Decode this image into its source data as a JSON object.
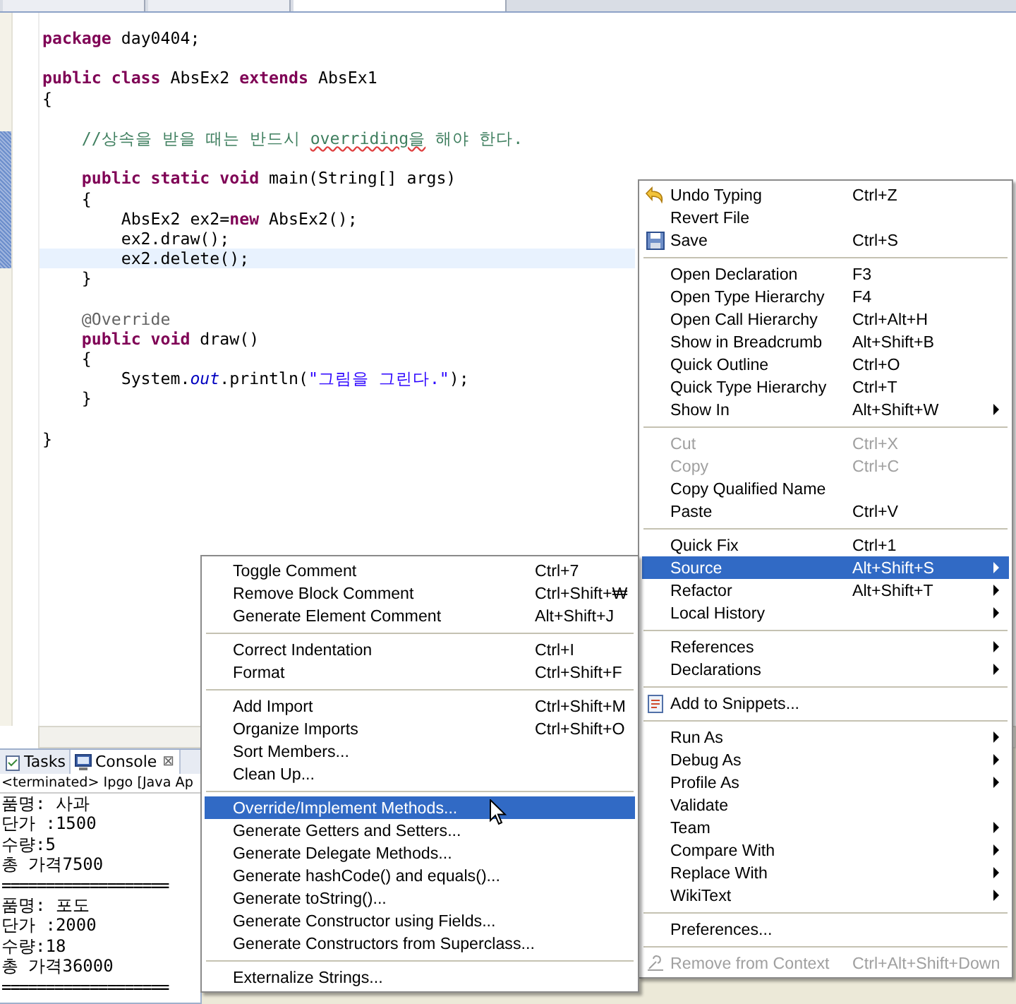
{
  "editor_tabs": [
    {
      "selected": false
    },
    {
      "selected": false
    },
    {
      "selected": true
    }
  ],
  "code_lines": [
    {
      "current": false,
      "gap_before": false,
      "segments": [
        {
          "kind": "keyword",
          "text": "package"
        },
        {
          "kind": "plain",
          "text": " day0404;"
        }
      ]
    },
    {
      "current": false,
      "gap_before": true,
      "segments": [
        {
          "kind": "keyword",
          "text": "public class"
        },
        {
          "kind": "plain",
          "text": " AbsEx2 "
        },
        {
          "kind": "keyword",
          "text": "extends"
        },
        {
          "kind": "plain",
          "text": " AbsEx1"
        }
      ]
    },
    {
      "current": false,
      "gap_before": false,
      "segments": [
        {
          "kind": "plain",
          "text": "{"
        }
      ]
    },
    {
      "current": false,
      "gap_before": true,
      "segments": [
        {
          "kind": "comment",
          "text": "    //상속을 받을 때는 반드시 "
        },
        {
          "kind": "misspelled",
          "text": "overriding을"
        },
        {
          "kind": "comment",
          "text": " 해야 한다."
        }
      ]
    },
    {
      "current": false,
      "gap_before": true,
      "segments": [
        {
          "kind": "keyword",
          "text": "    public static void"
        },
        {
          "kind": "plain",
          "text": " main(String[] args)"
        }
      ]
    },
    {
      "current": false,
      "gap_before": false,
      "segments": [
        {
          "kind": "plain",
          "text": "    {"
        }
      ]
    },
    {
      "current": false,
      "gap_before": false,
      "segments": [
        {
          "kind": "plain",
          "text": "        AbsEx2 ex2="
        },
        {
          "kind": "keyword",
          "text": "new"
        },
        {
          "kind": "plain",
          "text": " AbsEx2();"
        }
      ]
    },
    {
      "current": false,
      "gap_before": false,
      "segments": [
        {
          "kind": "plain",
          "text": "        ex2.draw();"
        }
      ]
    },
    {
      "current": true,
      "gap_before": false,
      "segments": [
        {
          "kind": "plain",
          "text": "        ex2.delete();"
        }
      ]
    },
    {
      "current": false,
      "gap_before": false,
      "segments": [
        {
          "kind": "plain",
          "text": "    }"
        }
      ]
    },
    {
      "current": false,
      "gap_before": true,
      "segments": [
        {
          "kind": "annotation",
          "text": "    @Override"
        }
      ]
    },
    {
      "current": false,
      "gap_before": false,
      "segments": [
        {
          "kind": "keyword",
          "text": "    public void"
        },
        {
          "kind": "plain",
          "text": " draw()"
        }
      ]
    },
    {
      "current": false,
      "gap_before": false,
      "segments": [
        {
          "kind": "plain",
          "text": "    {"
        }
      ]
    },
    {
      "current": false,
      "gap_before": false,
      "segments": [
        {
          "kind": "plain",
          "text": "        System."
        },
        {
          "kind": "field",
          "text": "out"
        },
        {
          "kind": "plain",
          "text": ".println("
        },
        {
          "kind": "string",
          "text": "\"그림을 그린다.\""
        },
        {
          "kind": "plain",
          "text": ");"
        }
      ]
    },
    {
      "current": false,
      "gap_before": false,
      "segments": [
        {
          "kind": "plain",
          "text": "    }"
        }
      ]
    },
    {
      "current": false,
      "gap_before": true,
      "segments": [
        {
          "kind": "plain",
          "text": "}"
        }
      ]
    }
  ],
  "console": {
    "tabs": [
      {
        "label": "Tasks",
        "selected": false
      },
      {
        "label": "Console",
        "selected": true
      }
    ],
    "close": "⊠",
    "status": "<terminated> Ipgo [Java Ap",
    "lines": [
      {
        "kind": "output",
        "text": "품명: 사과"
      },
      {
        "kind": "output",
        "text": "단가 :1500"
      },
      {
        "kind": "output",
        "text": "수량:5"
      },
      {
        "kind": "output",
        "text": "총 가격7500"
      },
      {
        "kind": "rule",
        "text": "==================="
      },
      {
        "kind": "output",
        "text": "품명: 포도"
      },
      {
        "kind": "output",
        "text": "단가 :2000"
      },
      {
        "kind": "output",
        "text": "수량:18"
      },
      {
        "kind": "output",
        "text": "총 가격36000"
      },
      {
        "kind": "rule",
        "text": "==================="
      }
    ]
  },
  "context_menu": {
    "groups": [
      [
        {
          "label": "Undo Typing",
          "shortcut": "Ctrl+Z",
          "submenu": false,
          "disabled": false,
          "selected": false
        },
        {
          "label": "Revert File",
          "submenu": false,
          "disabled": false,
          "selected": false
        },
        {
          "label": "Save",
          "shortcut": "Ctrl+S",
          "submenu": false,
          "disabled": false,
          "selected": false
        }
      ],
      [
        {
          "label": "Open Declaration",
          "shortcut": "F3",
          "submenu": false,
          "disabled": false,
          "selected": false
        },
        {
          "label": "Open Type Hierarchy",
          "shortcut": "F4",
          "submenu": false,
          "disabled": false,
          "selected": false
        },
        {
          "label": "Open Call Hierarchy",
          "shortcut": "Ctrl+Alt+H",
          "submenu": false,
          "disabled": false,
          "selected": false
        },
        {
          "label": "Show in Breadcrumb",
          "shortcut": "Alt+Shift+B",
          "submenu": false,
          "disabled": false,
          "selected": false
        },
        {
          "label": "Quick Outline",
          "shortcut": "Ctrl+O",
          "submenu": false,
          "disabled": false,
          "selected": false
        },
        {
          "label": "Quick Type Hierarchy",
          "shortcut": "Ctrl+T",
          "submenu": false,
          "disabled": false,
          "selected": false
        },
        {
          "label": "Show In",
          "shortcut": "Alt+Shift+W",
          "submenu": true,
          "disabled": false,
          "selected": false
        }
      ],
      [
        {
          "label": "Cut",
          "shortcut": "Ctrl+X",
          "submenu": false,
          "disabled": true,
          "selected": false
        },
        {
          "label": "Copy",
          "shortcut": "Ctrl+C",
          "submenu": false,
          "disabled": true,
          "selected": false
        },
        {
          "label": "Copy Qualified Name",
          "submenu": false,
          "disabled": false,
          "selected": false
        },
        {
          "label": "Paste",
          "shortcut": "Ctrl+V",
          "submenu": false,
          "disabled": false,
          "selected": false
        }
      ],
      [
        {
          "label": "Quick Fix",
          "shortcut": "Ctrl+1",
          "submenu": false,
          "disabled": false,
          "selected": false
        },
        {
          "label": "Source",
          "shortcut": "Alt+Shift+S",
          "submenu": true,
          "disabled": false,
          "selected": true
        },
        {
          "label": "Refactor",
          "shortcut": "Alt+Shift+T",
          "submenu": true,
          "disabled": false,
          "selected": false
        },
        {
          "label": "Local History",
          "submenu": true,
          "disabled": false,
          "selected": false
        }
      ],
      [
        {
          "label": "References",
          "submenu": true,
          "disabled": false,
          "selected": false
        },
        {
          "label": "Declarations",
          "submenu": true,
          "disabled": false,
          "selected": false
        }
      ],
      [
        {
          "label": "Add to Snippets...",
          "submenu": false,
          "disabled": false,
          "selected": false
        }
      ],
      [
        {
          "label": "Run As",
          "submenu": true,
          "disabled": false,
          "selected": false
        },
        {
          "label": "Debug As",
          "submenu": true,
          "disabled": false,
          "selected": false
        },
        {
          "label": "Profile As",
          "submenu": true,
          "disabled": false,
          "selected": false
        },
        {
          "label": "Validate",
          "submenu": false,
          "disabled": false,
          "selected": false
        },
        {
          "label": "Team",
          "submenu": true,
          "disabled": false,
          "selected": false
        },
        {
          "label": "Compare With",
          "submenu": true,
          "disabled": false,
          "selected": false
        },
        {
          "label": "Replace With",
          "submenu": true,
          "disabled": false,
          "selected": false
        },
        {
          "label": "WikiText",
          "submenu": true,
          "disabled": false,
          "selected": false
        }
      ],
      [
        {
          "label": "Preferences...",
          "submenu": false,
          "disabled": false,
          "selected": false
        }
      ],
      [
        {
          "label": "Remove from Context",
          "shortcut": "Ctrl+Alt+Shift+Down",
          "submenu": false,
          "disabled": true,
          "selected": false
        }
      ]
    ]
  },
  "source_submenu": {
    "groups": [
      [
        {
          "label": "Toggle Comment",
          "shortcut": "Ctrl+7",
          "selected": false
        },
        {
          "label": "Remove Block Comment",
          "shortcut": "Ctrl+Shift+₩",
          "selected": false
        },
        {
          "label": "Generate Element Comment",
          "shortcut": "Alt+Shift+J",
          "selected": false
        }
      ],
      [
        {
          "label": "Correct Indentation",
          "shortcut": "Ctrl+I",
          "selected": false
        },
        {
          "label": "Format",
          "shortcut": "Ctrl+Shift+F",
          "selected": false
        }
      ],
      [
        {
          "label": "Add Import",
          "shortcut": "Ctrl+Shift+M",
          "selected": false
        },
        {
          "label": "Organize Imports",
          "shortcut": "Ctrl+Shift+O",
          "selected": false
        },
        {
          "label": "Sort Members...",
          "selected": false
        },
        {
          "label": "Clean Up...",
          "selected": false
        }
      ],
      [
        {
          "label": "Override/Implement Methods...",
          "selected": true
        },
        {
          "label": "Generate Getters and Setters...",
          "selected": false
        },
        {
          "label": "Generate Delegate Methods...",
          "selected": false
        },
        {
          "label": "Generate hashCode() and equals()...",
          "selected": false
        },
        {
          "label": "Generate toString()...",
          "selected": false
        },
        {
          "label": "Generate Constructor using Fields...",
          "selected": false
        },
        {
          "label": "Generate Constructors from Superclass...",
          "selected": false
        }
      ],
      [
        {
          "label": "Externalize Strings...",
          "selected": false
        }
      ]
    ]
  }
}
